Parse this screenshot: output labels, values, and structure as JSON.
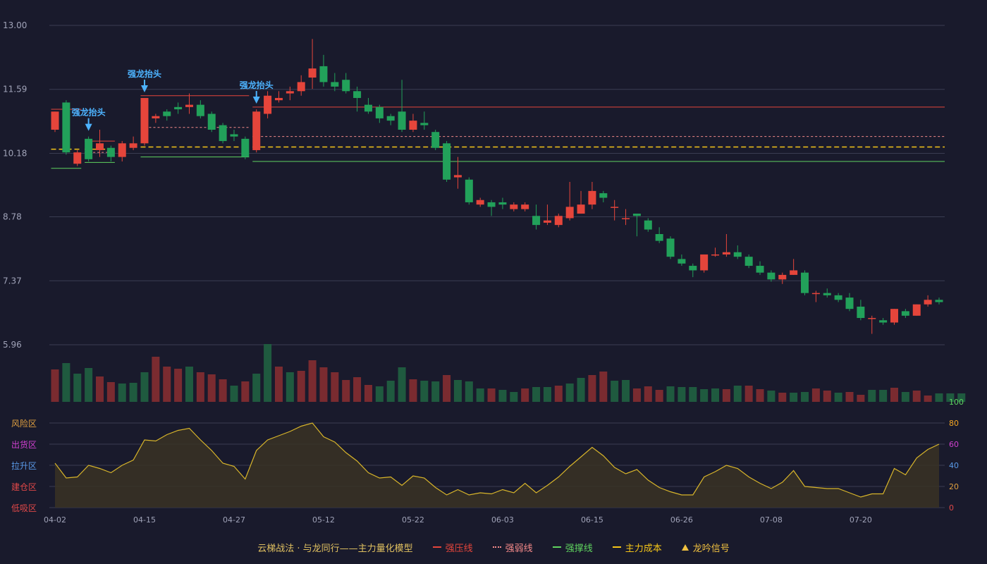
{
  "colors": {
    "bg": "#191a2c",
    "up": "#e5453b",
    "down": "#22a15a",
    "vol_up": "#7a2b30",
    "vol_down": "#1f5a3f",
    "resist": "#e5453b",
    "weak": "#f58a8a",
    "support": "#5fd35f",
    "cost": "#f5c518",
    "osc": "#d8b52a",
    "signal": "#4db3ff",
    "grid": "#3a3c52"
  },
  "chart_data": {
    "type": "candlestick",
    "price_axis": {
      "ticks": [
        "13.00",
        "11.59",
        "10.18",
        "8.78",
        "7.37",
        "5.96"
      ],
      "range": [
        5.96,
        13.0
      ]
    },
    "date_ticks": [
      "04-02",
      "04-15",
      "04-27",
      "05-12",
      "05-22",
      "06-03",
      "06-15",
      "06-26",
      "07-08",
      "07-20"
    ],
    "candles": [
      [
        10.7,
        11.1,
        10.65,
        11.1
      ],
      [
        11.3,
        10.2,
        10.15,
        11.35
      ],
      [
        9.95,
        10.2,
        9.9,
        10.25
      ],
      [
        10.5,
        10.05,
        10.0,
        10.55
      ],
      [
        10.25,
        10.4,
        10.1,
        10.7
      ],
      [
        10.3,
        10.1,
        10.0,
        10.35
      ],
      [
        10.1,
        10.4,
        10.0,
        10.45
      ],
      [
        10.3,
        10.4,
        10.25,
        10.55
      ],
      [
        10.4,
        11.4,
        10.35,
        11.4
      ],
      [
        10.95,
        11.0,
        10.85,
        11.05
      ],
      [
        11.1,
        11.0,
        10.9,
        11.15
      ],
      [
        11.2,
        11.15,
        11.05,
        11.3
      ],
      [
        11.2,
        11.25,
        11.05,
        11.5
      ],
      [
        11.25,
        11.0,
        10.95,
        11.35
      ],
      [
        11.05,
        10.7,
        10.65,
        11.1
      ],
      [
        10.8,
        10.45,
        10.4,
        10.85
      ],
      [
        10.6,
        10.55,
        10.45,
        10.7
      ],
      [
        10.5,
        10.1,
        10.05,
        10.55
      ],
      [
        10.25,
        11.1,
        10.2,
        11.15
      ],
      [
        11.05,
        11.45,
        10.95,
        11.55
      ],
      [
        11.35,
        11.4,
        11.3,
        11.55
      ],
      [
        11.5,
        11.55,
        11.35,
        11.65
      ],
      [
        11.55,
        11.75,
        11.45,
        11.9
      ],
      [
        11.85,
        12.05,
        11.6,
        12.7
      ],
      [
        12.1,
        11.75,
        11.65,
        12.35
      ],
      [
        11.75,
        11.65,
        11.55,
        11.95
      ],
      [
        11.8,
        11.55,
        11.5,
        11.95
      ],
      [
        11.55,
        11.4,
        11.1,
        11.65
      ],
      [
        11.25,
        11.1,
        11.05,
        11.4
      ],
      [
        11.2,
        10.95,
        10.85,
        11.25
      ],
      [
        11.0,
        10.9,
        10.8,
        11.05
      ],
      [
        11.1,
        10.7,
        10.65,
        11.8
      ],
      [
        10.7,
        10.9,
        10.65,
        11.05
      ],
      [
        10.85,
        10.8,
        10.7,
        11.1
      ],
      [
        10.65,
        10.3,
        10.25,
        10.7
      ],
      [
        10.4,
        9.6,
        9.55,
        10.45
      ],
      [
        9.65,
        9.7,
        9.4,
        10.1
      ],
      [
        9.6,
        9.1,
        9.05,
        9.65
      ],
      [
        9.05,
        9.15,
        9.0,
        9.2
      ],
      [
        9.1,
        9.0,
        8.8,
        9.15
      ],
      [
        9.1,
        9.05,
        8.95,
        9.2
      ],
      [
        8.95,
        9.05,
        8.9,
        9.1
      ],
      [
        8.95,
        9.05,
        8.9,
        9.1
      ],
      [
        8.8,
        8.6,
        8.5,
        9.05
      ],
      [
        8.65,
        8.7,
        8.6,
        9.05
      ],
      [
        8.6,
        8.8,
        8.55,
        8.85
      ],
      [
        8.75,
        9.0,
        8.7,
        9.55
      ],
      [
        8.85,
        9.05,
        8.85,
        9.35
      ],
      [
        9.05,
        9.35,
        8.95,
        9.55
      ],
      [
        9.3,
        9.2,
        9.1,
        9.35
      ],
      [
        9.0,
        9.0,
        8.7,
        9.15
      ],
      [
        8.75,
        8.75,
        8.6,
        8.95
      ],
      [
        8.85,
        8.8,
        8.35,
        8.85
      ],
      [
        8.7,
        8.5,
        8.45,
        8.75
      ],
      [
        8.4,
        8.25,
        8.2,
        8.55
      ],
      [
        8.3,
        7.9,
        7.85,
        8.35
      ],
      [
        7.85,
        7.75,
        7.7,
        7.95
      ],
      [
        7.7,
        7.6,
        7.45,
        7.75
      ],
      [
        7.6,
        7.95,
        7.55,
        7.95
      ],
      [
        7.95,
        7.95,
        7.9,
        8.1
      ],
      [
        7.95,
        8.0,
        7.9,
        8.4
      ],
      [
        8.0,
        7.9,
        7.85,
        8.15
      ],
      [
        7.9,
        7.7,
        7.65,
        7.95
      ],
      [
        7.7,
        7.55,
        7.5,
        7.8
      ],
      [
        7.55,
        7.4,
        7.35,
        7.6
      ],
      [
        7.4,
        7.5,
        7.3,
        7.55
      ],
      [
        7.5,
        7.6,
        7.5,
        7.85
      ],
      [
        7.55,
        7.1,
        7.05,
        7.6
      ],
      [
        7.1,
        7.1,
        6.9,
        7.15
      ],
      [
        7.1,
        7.05,
        7.0,
        7.2
      ],
      [
        7.05,
        6.95,
        6.9,
        7.1
      ],
      [
        7.0,
        6.75,
        6.7,
        7.1
      ],
      [
        6.8,
        6.55,
        6.5,
        6.95
      ],
      [
        6.55,
        6.55,
        6.2,
        6.6
      ],
      [
        6.5,
        6.45,
        6.4,
        6.55
      ],
      [
        6.45,
        6.75,
        6.4,
        6.75
      ],
      [
        6.7,
        6.6,
        6.55,
        6.75
      ],
      [
        6.6,
        6.85,
        6.6,
        6.85
      ],
      [
        6.85,
        6.95,
        6.8,
        7.05
      ],
      [
        6.95,
        6.9,
        6.85,
        7.0
      ]
    ],
    "volume_up": [
      true,
      false,
      false,
      false,
      true,
      true,
      false,
      false,
      false,
      true,
      true,
      true,
      false,
      true,
      true,
      true,
      false,
      true,
      false,
      false,
      true,
      false,
      true,
      true,
      true,
      true,
      true,
      true,
      true,
      false,
      false,
      false,
      true,
      false,
      false,
      true,
      false,
      false,
      false,
      true,
      false,
      false,
      true,
      false,
      false,
      true,
      false,
      false,
      true,
      true,
      false,
      false,
      true,
      true,
      true,
      false,
      false,
      false,
      false,
      false,
      true,
      false,
      true,
      true,
      false,
      true,
      false,
      false,
      true,
      true,
      false,
      true,
      true,
      false,
      false,
      true,
      false,
      true,
      true,
      false
    ],
    "volume": [
      46,
      55,
      40,
      48,
      36,
      28,
      26,
      27,
      42,
      64,
      50,
      47,
      50,
      42,
      39,
      32,
      23,
      29,
      40,
      82,
      50,
      42,
      44,
      59,
      49,
      42,
      31,
      35,
      24,
      22,
      30,
      49,
      32,
      30,
      29,
      38,
      31,
      29,
      19,
      19,
      17,
      14,
      19,
      21,
      21,
      23,
      26,
      34,
      38,
      43,
      30,
      31,
      19,
      22,
      17,
      22,
      21,
      21,
      18,
      19,
      18,
      23,
      23,
      18,
      16,
      13,
      13,
      14,
      19,
      16,
      13,
      14,
      10,
      17,
      17,
      20,
      14,
      16,
      9,
      12,
      12,
      12
    ],
    "levels": [
      {
        "name": "强压线",
        "style": "resist",
        "segments": [
          [
            0,
            2,
            11.15
          ],
          [
            3,
            5,
            10.45
          ],
          [
            8,
            17,
            11.45
          ],
          [
            18,
            79,
            11.2
          ]
        ]
      },
      {
        "name": "强弱线",
        "style": "weak",
        "segments": [
          [
            3,
            5,
            10.2
          ],
          [
            8,
            17,
            10.75
          ],
          [
            18,
            79,
            10.55
          ]
        ]
      },
      {
        "name": "强撑线",
        "style": "support",
        "segments": [
          [
            0,
            2,
            9.85
          ],
          [
            3,
            5,
            9.98
          ],
          [
            8,
            17,
            10.1
          ],
          [
            18,
            79,
            10.0
          ]
        ]
      },
      {
        "name": "主力成本",
        "style": "cost",
        "segments": [
          [
            0,
            2,
            10.27
          ],
          [
            3,
            5,
            10.27
          ],
          [
            8,
            17,
            10.32
          ],
          [
            18,
            79,
            10.32
          ]
        ]
      }
    ],
    "signals": [
      {
        "index": 3,
        "label": "强龙抬头"
      },
      {
        "index": 8,
        "label": "强龙抬头"
      },
      {
        "index": 18,
        "label": "强龙抬头"
      }
    ],
    "oscillator": {
      "zones": [
        "风险区",
        "出货区",
        "拉升区",
        "建仓区",
        "低吸区"
      ],
      "right_ticks": [
        "100",
        "80",
        "60",
        "40",
        "20",
        "0"
      ],
      "range": [
        0,
        100
      ],
      "values": [
        42,
        28,
        29,
        40,
        37,
        33,
        40,
        45,
        64,
        63,
        69,
        73,
        75,
        64,
        54,
        42,
        39,
        27,
        54,
        64,
        68,
        72,
        77,
        80,
        67,
        62,
        52,
        44,
        33,
        28,
        29,
        21,
        30,
        28,
        19,
        12,
        17,
        12,
        14,
        13,
        17,
        14,
        23,
        14,
        21,
        29,
        39,
        48,
        57,
        49,
        38,
        32,
        36,
        26,
        19,
        15,
        12,
        12,
        29,
        34,
        40,
        37,
        29,
        23,
        18,
        24,
        35,
        20,
        19,
        18,
        18,
        14,
        10,
        13,
        13,
        37,
        31,
        47,
        55,
        60
      ]
    }
  },
  "legend": {
    "model": "云梯战法 · 与龙同行——主力量化模型",
    "resist": "强压线",
    "weak": "强弱线",
    "support": "强撑线",
    "cost": "主力成本",
    "signal": "龙吟信号"
  }
}
